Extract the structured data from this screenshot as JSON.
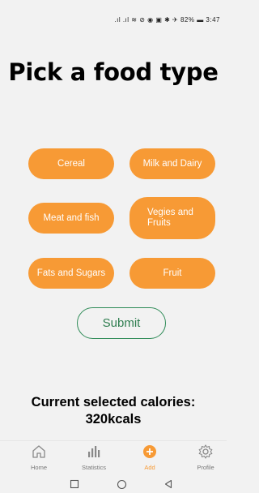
{
  "status_bar": {
    "indicators": ".ıl .ıl ≋ ⊘   ◉ ▣ ✱ ✈ 82% ▬ 3:47"
  },
  "title": "Pick a food type",
  "food_types": [
    {
      "label": "Cereal"
    },
    {
      "label": "Milk and Dairy"
    },
    {
      "label": "Meat and fish"
    },
    {
      "label": "Vegies and Fruits"
    },
    {
      "label": "Fats and Sugars"
    },
    {
      "label": "Fruit"
    }
  ],
  "submit_label": "Submit",
  "calories": {
    "label": "Current selected calories:",
    "value": "320kcals"
  },
  "bottom_nav": {
    "items": [
      {
        "label": "Home",
        "icon": "home-icon"
      },
      {
        "label": "Statistics",
        "icon": "bar-chart-icon"
      },
      {
        "label": "Add",
        "icon": "add-circle-icon",
        "active": true
      },
      {
        "label": "Profile",
        "icon": "gear-icon"
      }
    ]
  },
  "colors": {
    "accent": "#f79a35",
    "submit_border": "#2e8b57",
    "background": "#f2f2f2"
  }
}
